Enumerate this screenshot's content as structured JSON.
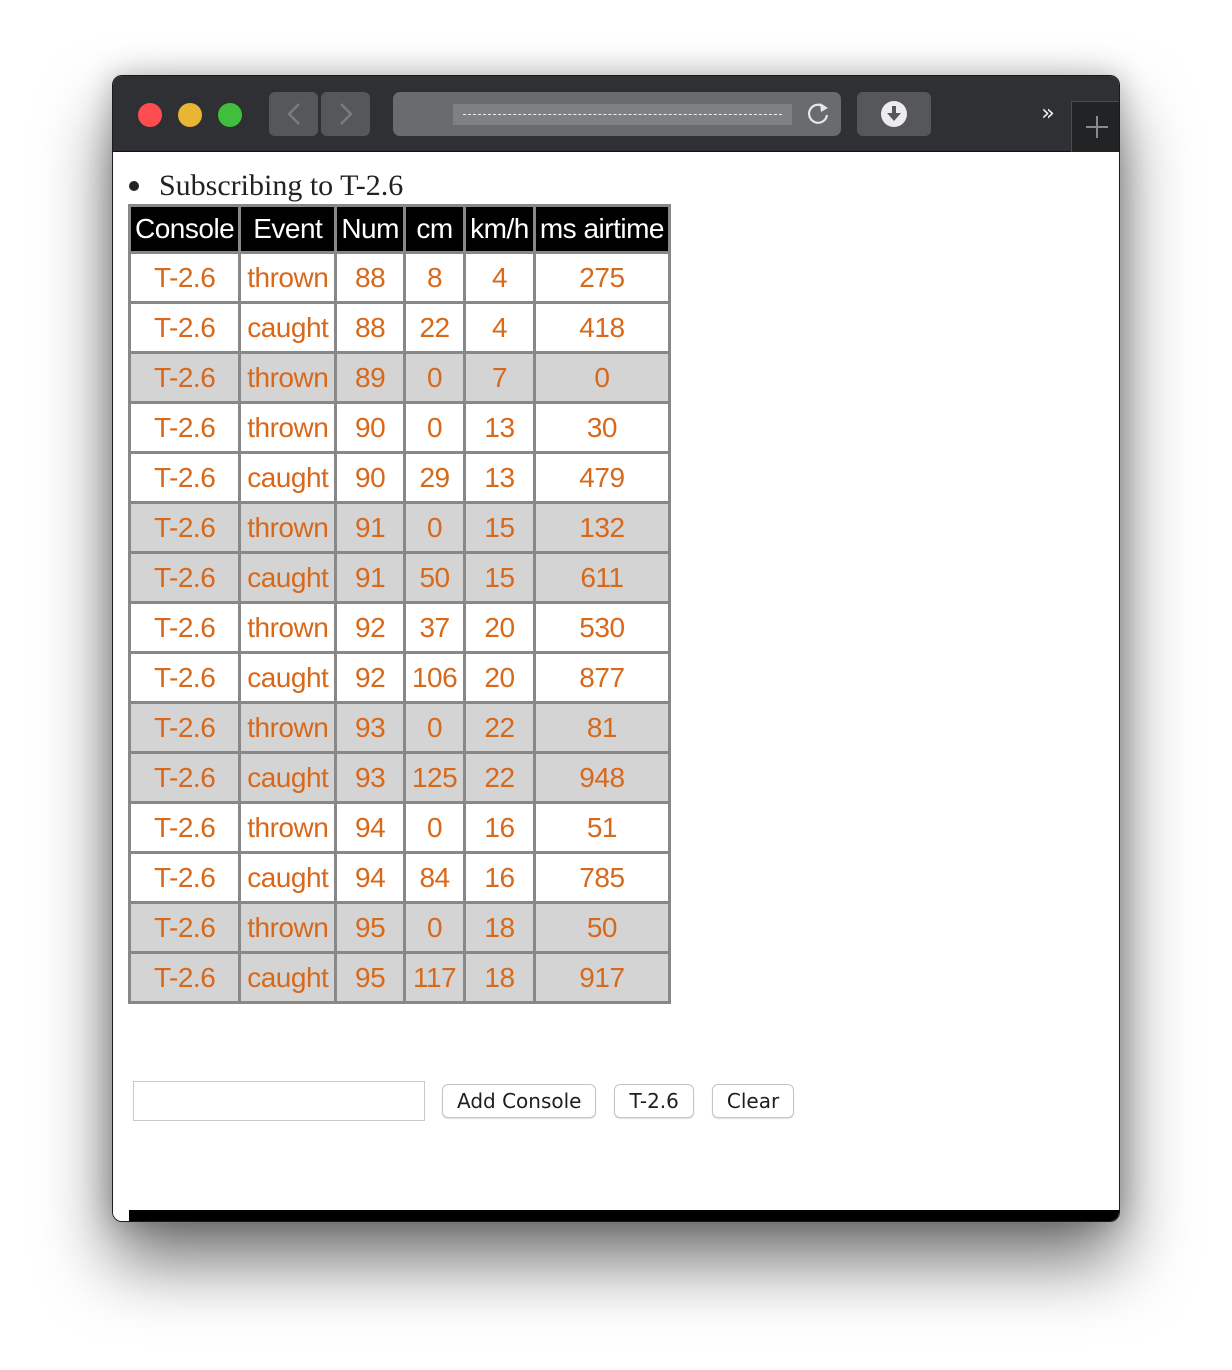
{
  "browser": {
    "traffic_lights": [
      "close",
      "minimize",
      "maximize"
    ],
    "back_icon": "chevron-left-icon",
    "forward_icon": "chevron-right-icon",
    "address_text": "",
    "reload_icon": "reload-icon",
    "download_icon": "download-icon",
    "overflow_label": "››",
    "new_tab_icon": "plus-icon"
  },
  "page": {
    "subscription_text": "Subscribing to T-2.6",
    "table": {
      "headers": [
        "Console",
        "Event",
        "Num",
        "cm",
        "km/h",
        "ms airtime"
      ],
      "rows": [
        {
          "console": "T-2.6",
          "event": "thrown",
          "num": "88",
          "cm": "8",
          "kmh": "4",
          "airtime": "275",
          "shaded": false
        },
        {
          "console": "T-2.6",
          "event": "caught",
          "num": "88",
          "cm": "22",
          "kmh": "4",
          "airtime": "418",
          "shaded": false
        },
        {
          "console": "T-2.6",
          "event": "thrown",
          "num": "89",
          "cm": "0",
          "kmh": "7",
          "airtime": "0",
          "shaded": true
        },
        {
          "console": "T-2.6",
          "event": "thrown",
          "num": "90",
          "cm": "0",
          "kmh": "13",
          "airtime": "30",
          "shaded": false
        },
        {
          "console": "T-2.6",
          "event": "caught",
          "num": "90",
          "cm": "29",
          "kmh": "13",
          "airtime": "479",
          "shaded": false
        },
        {
          "console": "T-2.6",
          "event": "thrown",
          "num": "91",
          "cm": "0",
          "kmh": "15",
          "airtime": "132",
          "shaded": true
        },
        {
          "console": "T-2.6",
          "event": "caught",
          "num": "91",
          "cm": "50",
          "kmh": "15",
          "airtime": "611",
          "shaded": true
        },
        {
          "console": "T-2.6",
          "event": "thrown",
          "num": "92",
          "cm": "37",
          "kmh": "20",
          "airtime": "530",
          "shaded": false
        },
        {
          "console": "T-2.6",
          "event": "caught",
          "num": "92",
          "cm": "106",
          "kmh": "20",
          "airtime": "877",
          "shaded": false
        },
        {
          "console": "T-2.6",
          "event": "thrown",
          "num": "93",
          "cm": "0",
          "kmh": "22",
          "airtime": "81",
          "shaded": true
        },
        {
          "console": "T-2.6",
          "event": "caught",
          "num": "93",
          "cm": "125",
          "kmh": "22",
          "airtime": "948",
          "shaded": true
        },
        {
          "console": "T-2.6",
          "event": "thrown",
          "num": "94",
          "cm": "0",
          "kmh": "16",
          "airtime": "51",
          "shaded": false
        },
        {
          "console": "T-2.6",
          "event": "caught",
          "num": "94",
          "cm": "84",
          "kmh": "16",
          "airtime": "785",
          "shaded": false
        },
        {
          "console": "T-2.6",
          "event": "thrown",
          "num": "95",
          "cm": "0",
          "kmh": "18",
          "airtime": "50",
          "shaded": true
        },
        {
          "console": "T-2.6",
          "event": "caught",
          "num": "95",
          "cm": "117",
          "kmh": "18",
          "airtime": "917",
          "shaded": true
        }
      ]
    },
    "controls": {
      "console_input_value": "",
      "console_input_placeholder": "",
      "add_console_label": "Add Console",
      "console_button_label": "T-2.6",
      "clear_label": "Clear"
    }
  },
  "colors": {
    "cell_text": "#d8681a",
    "header_bg": "#000000",
    "shaded_row_bg": "#d4d4d4",
    "border": "#888888"
  }
}
